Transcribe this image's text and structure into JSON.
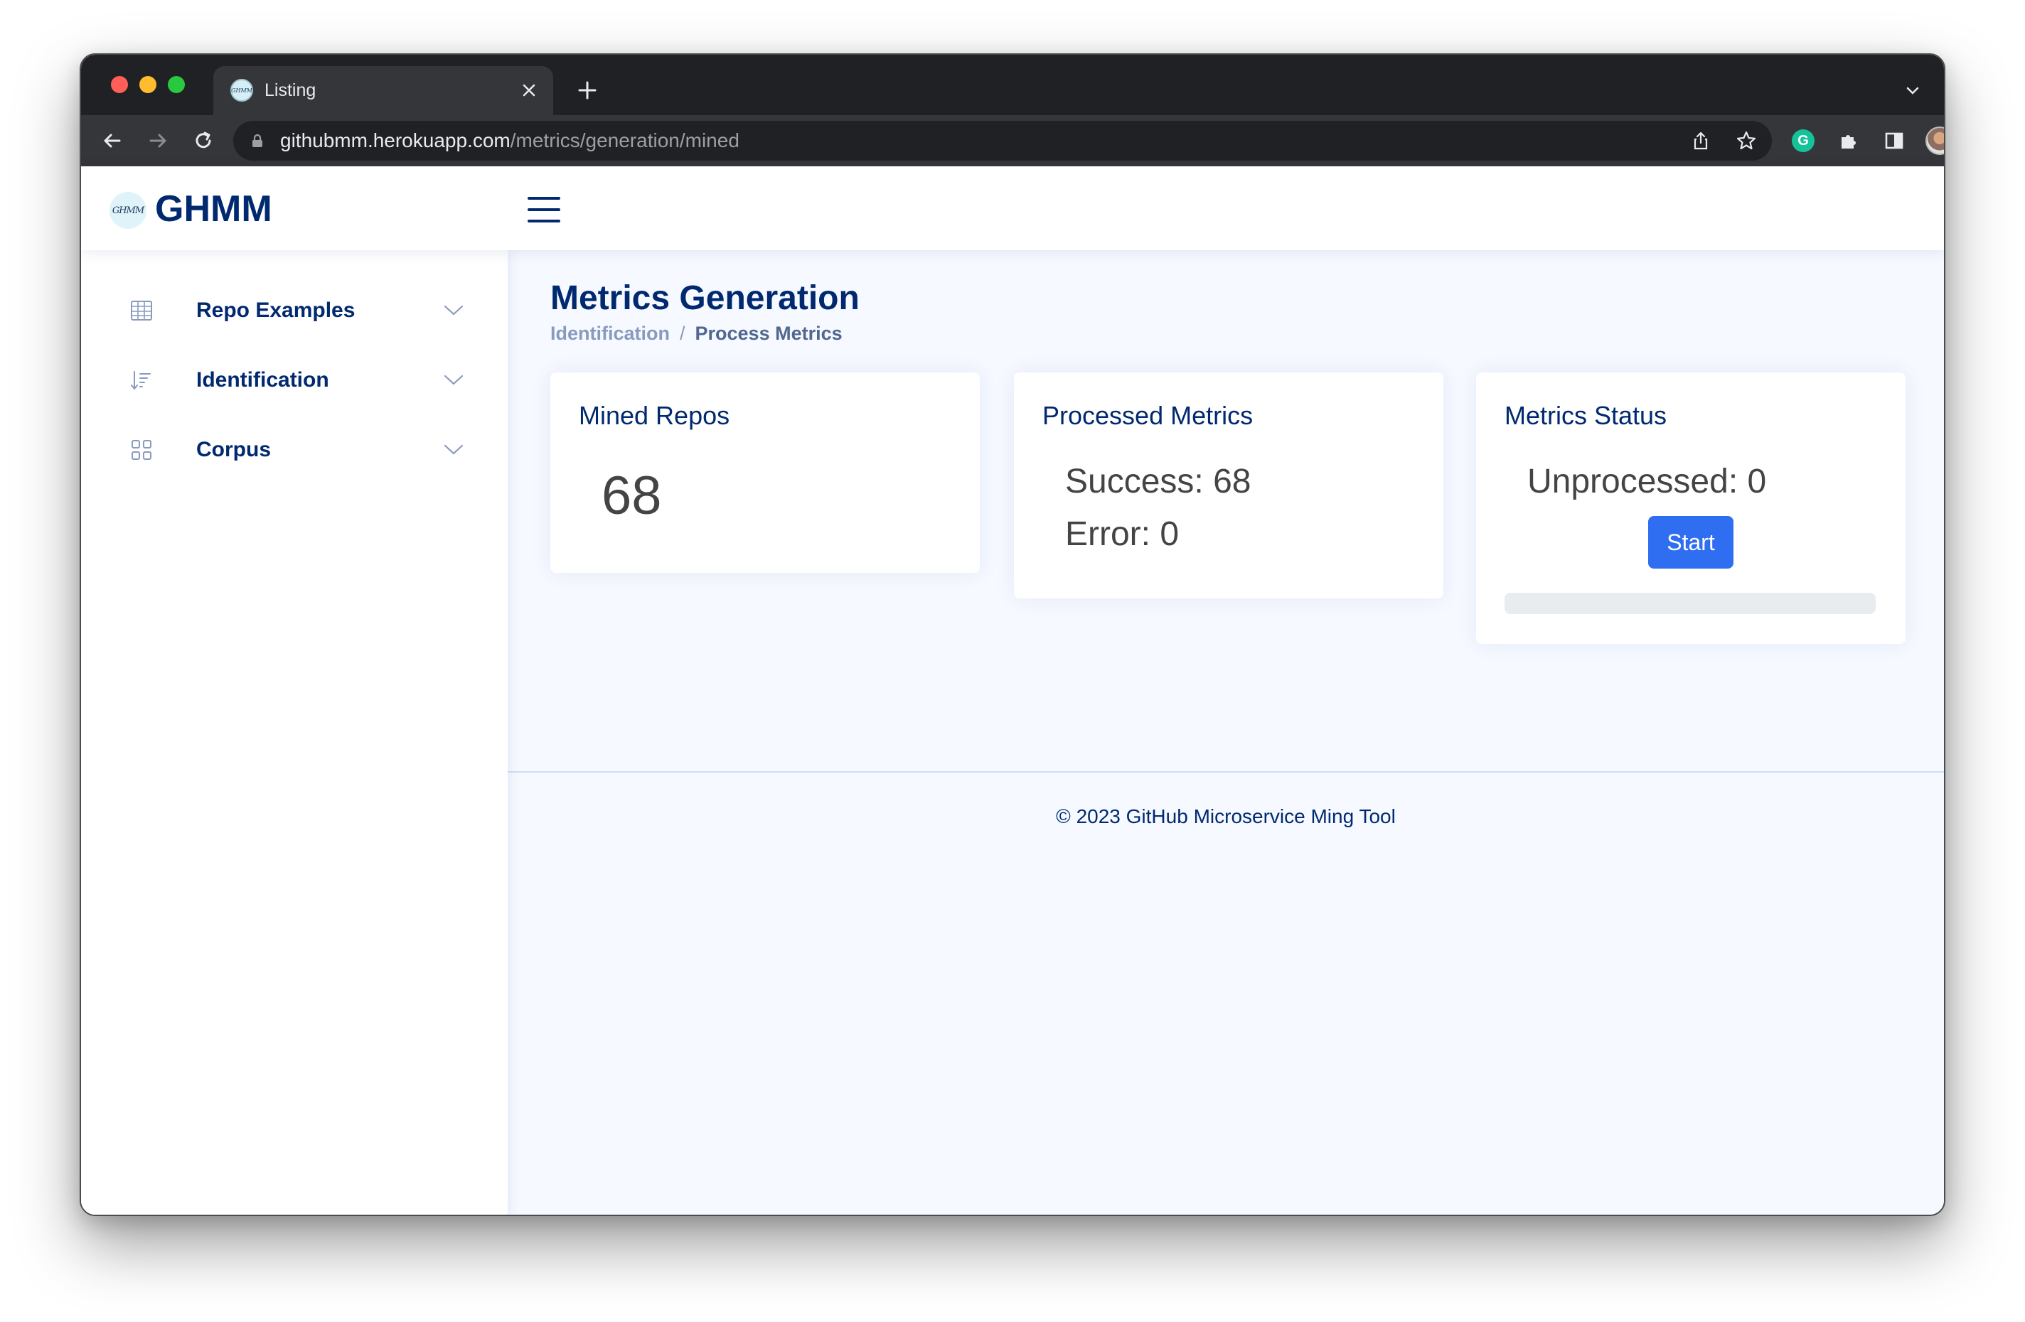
{
  "browser": {
    "tab_title": "Listing",
    "url_host": "githubmm.herokuapp.com",
    "url_path": "/metrics/generation/mined"
  },
  "header": {
    "logo_text": "GHMM",
    "logo_mark": "GHMM"
  },
  "sidebar": {
    "items": [
      {
        "label": "Repo Examples",
        "icon": "table-icon"
      },
      {
        "label": "Identification",
        "icon": "sort-icon"
      },
      {
        "label": "Corpus",
        "icon": "grid-icon"
      }
    ]
  },
  "main": {
    "title": "Metrics Generation",
    "breadcrumb": [
      "Identification",
      "/",
      "Process Metrics"
    ],
    "cards": {
      "mined": {
        "title": "Mined Repos",
        "value": "68"
      },
      "processed": {
        "title": "Processed Metrics",
        "success": "Success: 68",
        "error": "Error: 0"
      },
      "status": {
        "title": "Metrics Status",
        "unprocessed": "Unprocessed: 0",
        "button": "Start",
        "progress": 0
      }
    }
  },
  "footer": {
    "text": "© 2023 GitHub Microservice Ming Tool"
  },
  "colors": {
    "brand": "#012970",
    "primary_button": "#2f6ef0",
    "page_bg": "#f6f9ff"
  }
}
